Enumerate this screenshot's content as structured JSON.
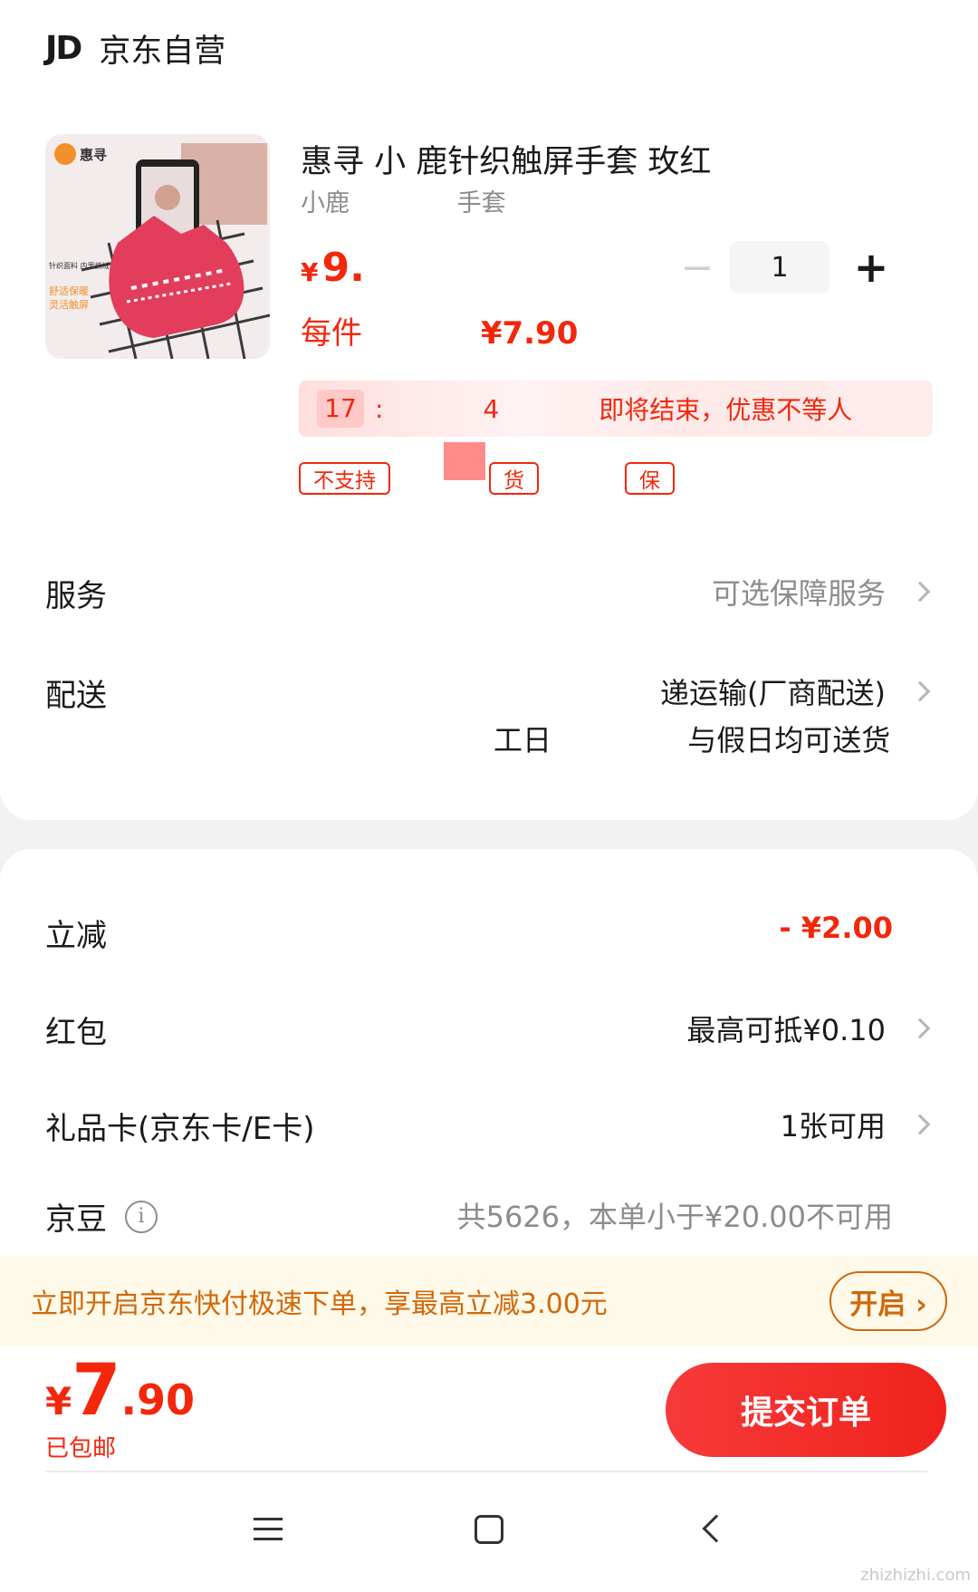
{
  "store": {
    "logo": "JD",
    "name": "京东自营"
  },
  "product": {
    "title": "惠寻 小 鹿针织触屏手套 玫红",
    "spec_left": "小鹿",
    "spec_right": "手套",
    "price_symbol": "¥",
    "price_partial": "9.",
    "per_label": "每件",
    "per_price": "¥7.90",
    "image_brand": "惠寻",
    "image_text1": "针织面料 内里抓绒",
    "image_text2": "舒适保暖",
    "image_text3": "灵活触屏"
  },
  "quantity": {
    "value": "1",
    "minus": "−",
    "plus": "+"
  },
  "countdown": {
    "hours": "17",
    "sep": ":",
    "mins": "4",
    "text": "即将结束，优惠不等人"
  },
  "tags": [
    "不支持",
    "货",
    "保"
  ],
  "rows": {
    "service_label": "服务",
    "service_value": "可选保障服务",
    "delivery_label": "配送",
    "delivery_line1": "递运输(厂商配送)",
    "delivery_line2_a": "工日",
    "delivery_line2_b": "与假日均可送货"
  },
  "discounts": {
    "instant_label": "立减",
    "instant_value": "- ¥2.00",
    "hongbao_label": "红包",
    "hongbao_value": "最高可抵¥0.10",
    "giftcard_label": "礼品卡(京东卡/E卡)",
    "giftcard_value": "1张可用",
    "jingdou_label": "京豆",
    "jingdou_value": "共5626，本单小于¥20.00不可用",
    "info_glyph": "i"
  },
  "banner": {
    "text": "立即开启京东快付极速下单，享最高立减3.00元",
    "button": "开启 ›"
  },
  "checkout": {
    "yen": "¥",
    "int": "7",
    "dec": ".90",
    "shipping": "已包邮",
    "submit": "提交订单"
  },
  "watermark": "zhizhizhi.com",
  "colors": {
    "accent": "#f2270c",
    "banner_text": "#d0690a",
    "banner_bg": "#fff9ea"
  }
}
